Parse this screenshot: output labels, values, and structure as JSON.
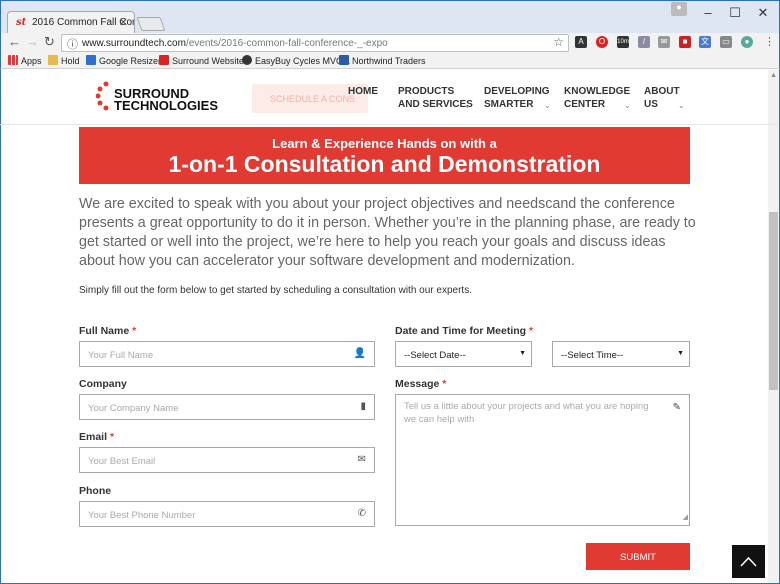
{
  "browser": {
    "tab_title": "2016 Common Fall Confe",
    "tab_favicon": "st",
    "url_prefix": "www.surroundtech.com",
    "url_path": "/events/2016-common-fall-conference-_-expo",
    "bookmarks": [
      "Apps",
      "Hold",
      "Google Resizer",
      "Surround Website",
      "EasyBuy Cycles MVC L",
      "Northwind Traders"
    ],
    "ext_badge": "10m"
  },
  "header": {
    "logo_line1": "SURROUND",
    "logo_line2": "TECHNOLOGIES",
    "schedule_label": "SCHEDULE A CONS",
    "nav": [
      {
        "line1": "HOME",
        "line2": ""
      },
      {
        "line1": "PRODUCTS",
        "line2": "AND SERVICES"
      },
      {
        "line1": "DEVELOPING",
        "line2": "SMARTER"
      },
      {
        "line1": "KNOWLEDGE",
        "line2": "CENTER"
      },
      {
        "line1": "ABOUT",
        "line2": "US"
      }
    ]
  },
  "banner": {
    "subtitle": "Learn & Experience Hands on with a",
    "title": "1-on-1 Consultation and Demonstration",
    "color": "#e03a33"
  },
  "intro": "We are excited to speak with you about your project objectives and needscand the conference presents a great opportunity to do it in person. Whether you’re in the planning phase, are ready to get started or well into the project, we’re here to help you reach your goals and discuss ideas about how you can accelerator your software development and modernization.",
  "instructions": "Simply fill out the form below to get started by scheduling a consultation with our experts.",
  "form": {
    "full_name_label": "Full Name",
    "full_name_placeholder": "Your Full Name",
    "company_label": "Company",
    "company_placeholder": "Your Company Name",
    "email_label": "Email",
    "email_placeholder": "Your Best Email",
    "phone_label": "Phone",
    "phone_placeholder": "Your Best Phone Number",
    "datetime_label": "Date and Time for Meeting",
    "date_value": "--Select Date--",
    "time_value": "--Select Time--",
    "message_label": "Message",
    "message_placeholder": "Tell us a little about your projects and what you are hoping we can help with",
    "required_mark": "*",
    "submit_label": "SUBMIT"
  }
}
